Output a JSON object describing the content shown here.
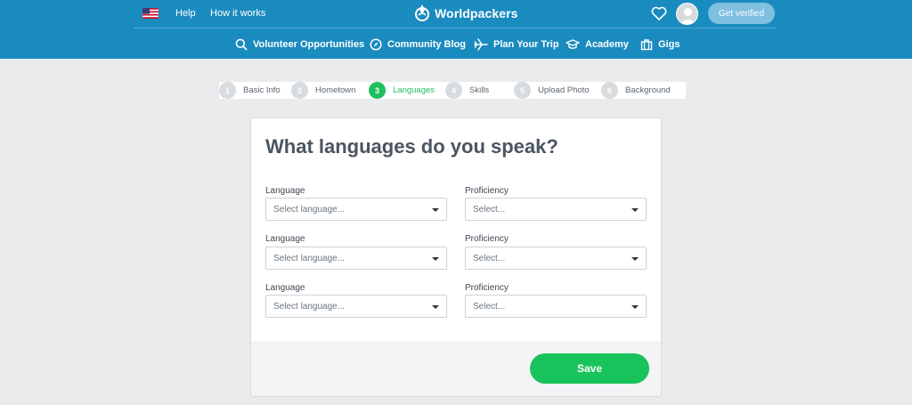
{
  "header": {
    "help": "Help",
    "how_it_works": "How it works",
    "brand": "Worldpackers",
    "get_verified": "Get verified",
    "colors": {
      "bar": "#1a8bbf",
      "verify": "#7fbfe0"
    }
  },
  "nav": {
    "items": [
      {
        "label": "Volunteer Opportunities",
        "icon": "search-icon"
      },
      {
        "label": "Community Blog",
        "icon": "compass-icon"
      },
      {
        "label": "Plan Your Trip",
        "icon": "plane-icon"
      },
      {
        "label": "Academy",
        "icon": "graduation-cap-icon"
      },
      {
        "label": "Gigs",
        "icon": "briefcase-icon"
      }
    ]
  },
  "stepper": {
    "steps": [
      {
        "num": "1",
        "label": "Basic Info"
      },
      {
        "num": "2",
        "label": "Hometown"
      },
      {
        "num": "3",
        "label": "Languages",
        "active": true
      },
      {
        "num": "4",
        "label": "Skills"
      },
      {
        "num": "5",
        "label": "Upload Photo"
      },
      {
        "num": "6",
        "label": "Background"
      }
    ],
    "active_color": "#1fbf5f"
  },
  "form": {
    "title": "What languages do you speak?",
    "rows": [
      {
        "language_label": "Language",
        "language_value": "Select language...",
        "proficiency_label": "Proficiency",
        "proficiency_value": "Select..."
      },
      {
        "language_label": "Language",
        "language_value": "Select language...",
        "proficiency_label": "Proficiency",
        "proficiency_value": "Select..."
      },
      {
        "language_label": "Language",
        "language_value": "Select language...",
        "proficiency_label": "Proficiency",
        "proficiency_value": "Select..."
      }
    ],
    "save": "Save",
    "save_color": "#19c35c"
  }
}
